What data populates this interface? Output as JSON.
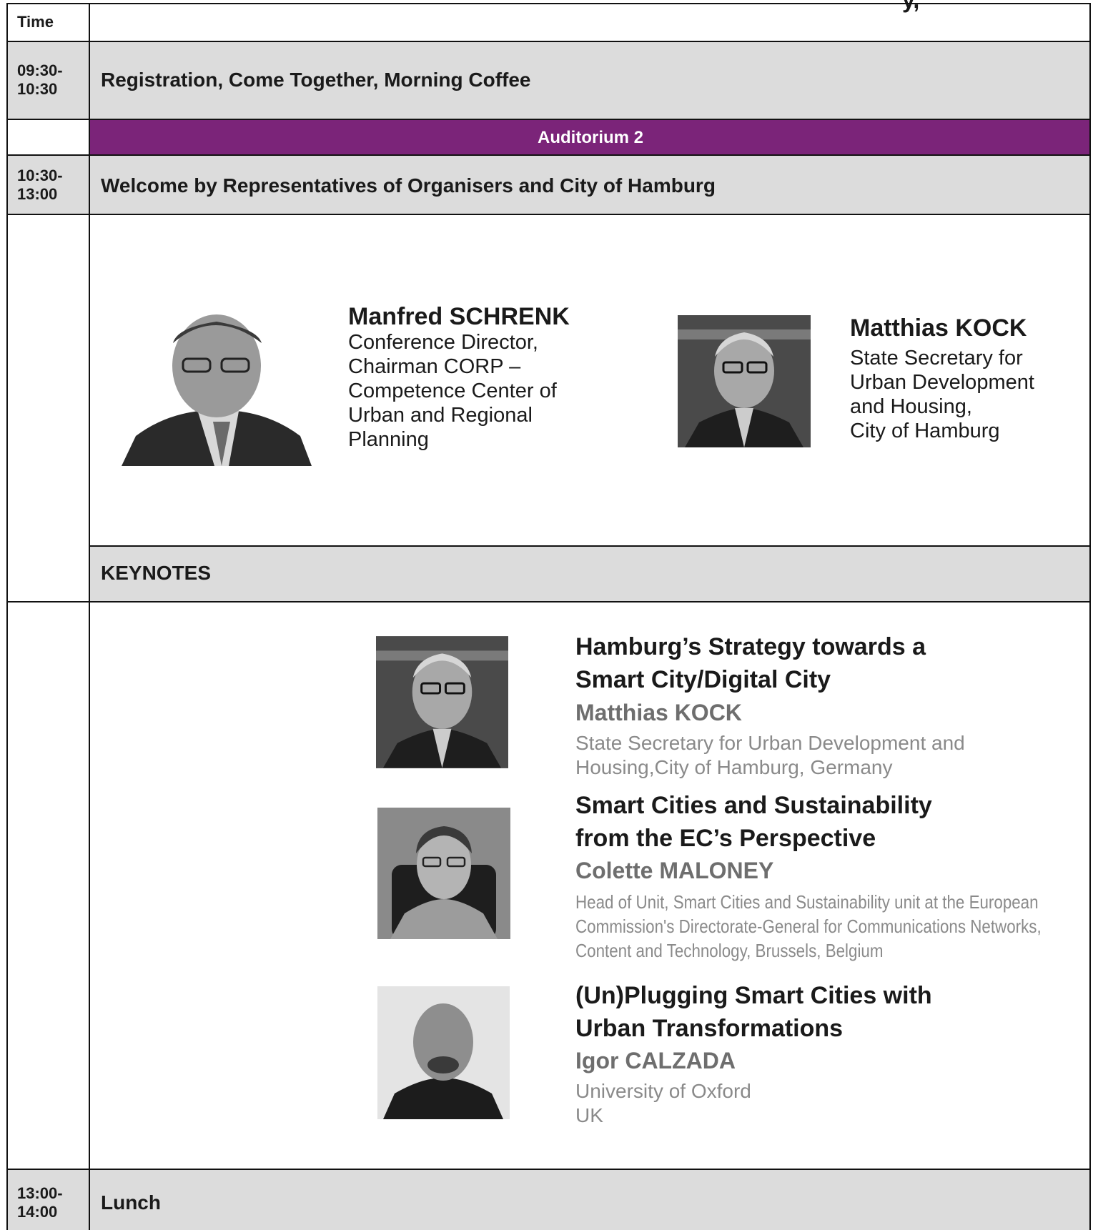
{
  "header": {
    "time_label": "Time",
    "corner_text": "y,"
  },
  "rows": {
    "registration": {
      "time": "09:30-\n10:30",
      "title": "Registration, Come Together, Morning Coffee"
    },
    "room": {
      "label": "Auditorium 2"
    },
    "welcome": {
      "time": "10:30-\n13:00",
      "title": "Welcome by Representatives of Organisers and City of Hamburg"
    },
    "keynotes_header": {
      "title": "KEYNOTES"
    },
    "lunch": {
      "time": "13:00-\n14:00",
      "title": "Lunch"
    }
  },
  "welcome_speakers": [
    {
      "name": "Manfred SCHRENK",
      "role": "Conference Director,\nChairman CORP –\nCompetence Center of\nUrban and Regional\nPlanning",
      "photo": "portrait-photo"
    },
    {
      "name": "Matthias KOCK",
      "role": "State Secretary for\nUrban Development\nand Housing,\nCity of Hamburg",
      "photo": "portrait-photo"
    }
  ],
  "keynotes": [
    {
      "title": "Hamburg’s Strategy towards a\nSmart City/Digital City",
      "speaker": "Matthias KOCK",
      "affiliation": "State Secretary for Urban Development and\nHousing,City of Hamburg, Germany"
    },
    {
      "title": "Smart Cities and Sustainability\nfrom the EC’s Perspective",
      "speaker": "Colette MALONEY",
      "affiliation": "Head of Unit, Smart Cities and Sustainability unit at the European\nCommission's Directorate-General for Communications Networks,\nContent and Technology, Brussels, Belgium"
    },
    {
      "title": "(Un)Plugging Smart Cities with\nUrban Transformations",
      "speaker": "Igor CALZADA",
      "affiliation": "University of Oxford\nUK"
    }
  ],
  "colors": {
    "purple": "#7b2479",
    "gray_row": "#dcdcdc",
    "muted_text": "#8a8a8a"
  }
}
